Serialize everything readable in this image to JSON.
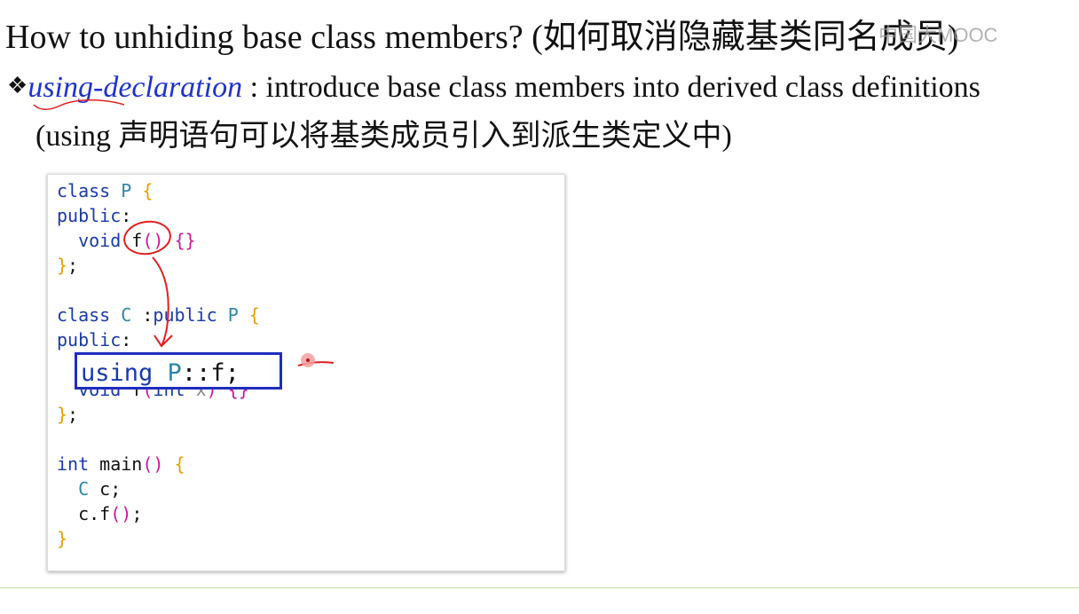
{
  "slide": {
    "title": "How to unhiding base class members? (如何取消隐藏基类同名成员)",
    "watermark": "中国大MOOC",
    "bullet": {
      "icon": "diamond-bullet-icon",
      "term": "using-declaration",
      "text": " : introduce base class members into derived class definitions",
      "subtext": "(using 声明语句可以将基类成员引入到派生类定义中)"
    },
    "code_lines": [
      "class P {",
      "public:",
      "  void f() {}",
      "};",
      "",
      "class C :public P {",
      "public:",
      "  using P::f;",
      "  void f(int x) {}",
      "};",
      "",
      "int main() {",
      "  C c;",
      "  c.f();",
      "}"
    ],
    "highlighted_line": "using P::f;",
    "colors": {
      "keyword": "#1a3aa8",
      "type_name": "#2e86a8",
      "brace": "#e4a000",
      "paren": "#c9179e",
      "term": "#1f33c8",
      "highlight_box": "#1f2dc0",
      "annotation_ink": "#e02020"
    }
  }
}
